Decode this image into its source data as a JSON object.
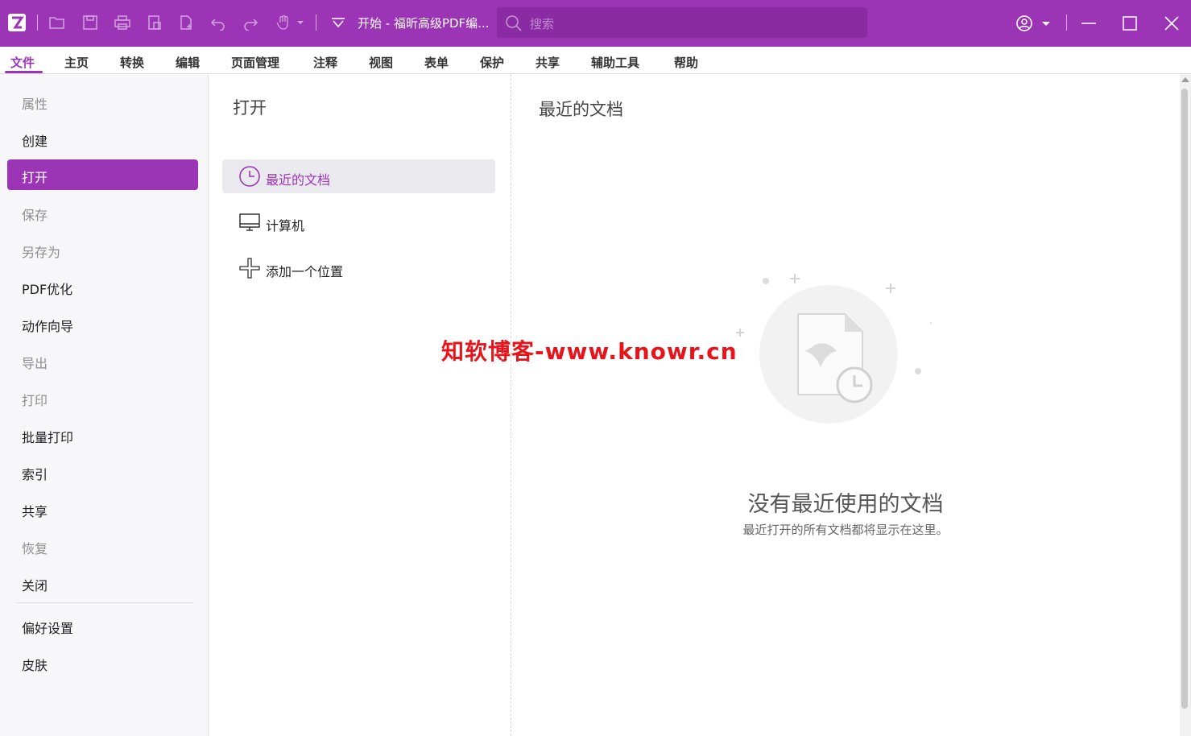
{
  "titlebar": {
    "doc_title": "开始 - 福昕高级PDF编...",
    "search_placeholder": "搜索"
  },
  "menu": [
    "文件",
    "主页",
    "转换",
    "编辑",
    "页面管理",
    "注释",
    "视图",
    "表单",
    "保护",
    "共享",
    "辅助工具",
    "帮助"
  ],
  "sidebar": {
    "items": [
      {
        "label": "属性",
        "state": "disabled"
      },
      {
        "label": "创建",
        "state": "normal"
      },
      {
        "label": "打开",
        "state": "active"
      },
      {
        "label": "保存",
        "state": "disabled"
      },
      {
        "label": "另存为",
        "state": "disabled"
      },
      {
        "label": "PDF优化",
        "state": "normal"
      },
      {
        "label": "动作向导",
        "state": "normal"
      },
      {
        "label": "导出",
        "state": "disabled"
      },
      {
        "label": "打印",
        "state": "disabled"
      },
      {
        "label": "批量打印",
        "state": "normal"
      },
      {
        "label": "索引",
        "state": "normal"
      },
      {
        "label": "共享",
        "state": "normal"
      },
      {
        "label": "恢复",
        "state": "disabled"
      },
      {
        "label": "关闭",
        "state": "normal"
      },
      {
        "label": "偏好设置",
        "state": "normal"
      },
      {
        "label": "皮肤",
        "state": "normal"
      }
    ]
  },
  "open_panel": {
    "title": "打开",
    "locations": [
      {
        "label": "最近的文档",
        "icon": "clock-icon",
        "selected": true
      },
      {
        "label": "计算机",
        "icon": "computer-icon",
        "selected": false
      },
      {
        "label": "添加一个位置",
        "icon": "plus-icon",
        "selected": false
      }
    ]
  },
  "recent": {
    "title": "最近的文档",
    "empty_title": "没有最近使用的文档",
    "empty_subtitle": "最近打开的所有文档都将显示在这里。"
  },
  "watermark": "知软博客-www.knowr.cn",
  "colors": {
    "brand": "#9b34b5",
    "watermark": "#e8141b"
  }
}
